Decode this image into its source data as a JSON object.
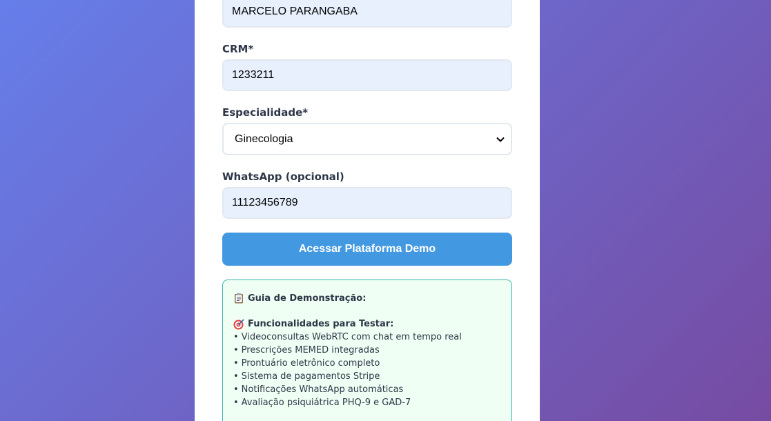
{
  "form": {
    "name_value": "MARCELO PARANGABA",
    "crm_label": "CRM*",
    "crm_value": "1233211",
    "specialty_label": "Especialidade*",
    "specialty_value": "Ginecologia",
    "whatsapp_label": "WhatsApp (opcional)",
    "whatsapp_value": "11123456789",
    "submit_label": "Acessar Plataforma Demo"
  },
  "guide": {
    "title": "Guia de Demonstração:",
    "subtitle": "Funcionalidades para Testar:",
    "bullet": "•",
    "features": [
      "Videoconsultas WebRTC com chat em tempo real",
      "Prescrições MEMED integradas",
      "Prontuário eletrônico completo",
      "Sistema de pagamentos Stripe",
      "Notificações WhatsApp automáticas",
      "Avaliação psiquiátrica PHQ-9 e GAD-7"
    ]
  },
  "icons": {
    "guide_title_icon": "clipboard-icon",
    "guide_subtitle_icon": "target-icon",
    "select_icon": "chevron-down-icon"
  },
  "colors": {
    "background_start": "#667eea",
    "background_end": "#764ba2",
    "button": "#4299e1",
    "input_fill": "#e8f0fe",
    "guide_border": "#38b2ac",
    "guide_fill": "#f0fff4"
  }
}
